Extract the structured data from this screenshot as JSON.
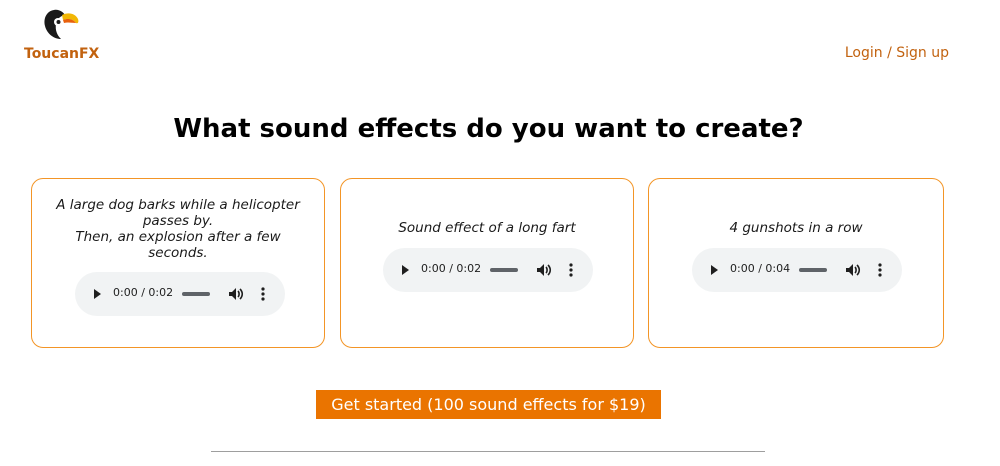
{
  "header": {
    "brand_name": "ToucanFX",
    "logo_icon": "toucan-logo",
    "login_label": "Login / Sign up"
  },
  "hero": {
    "title": "What sound effects do you want to create?"
  },
  "examples": [
    {
      "prompt_lines": [
        "A large dog barks while a helicopter",
        "passes by.",
        "Then, an explosion after a few",
        "seconds."
      ],
      "time": "0:00 / 0:02"
    },
    {
      "prompt_lines": [
        "Sound effect of a long fart"
      ],
      "time": "0:00 / 0:02"
    },
    {
      "prompt_lines": [
        "4 gunshots in a row"
      ],
      "time": "0:00 / 0:04"
    }
  ],
  "player_icons": [
    "play-icon",
    "volume-icon",
    "more-options-icon"
  ],
  "cta": {
    "label": "Get started (100 sound effects for $19)"
  },
  "colors": {
    "brand": "#c2620f",
    "card_border": "#f39526",
    "cta_background": "#ea7400",
    "player_background": "#f1f3f4"
  }
}
